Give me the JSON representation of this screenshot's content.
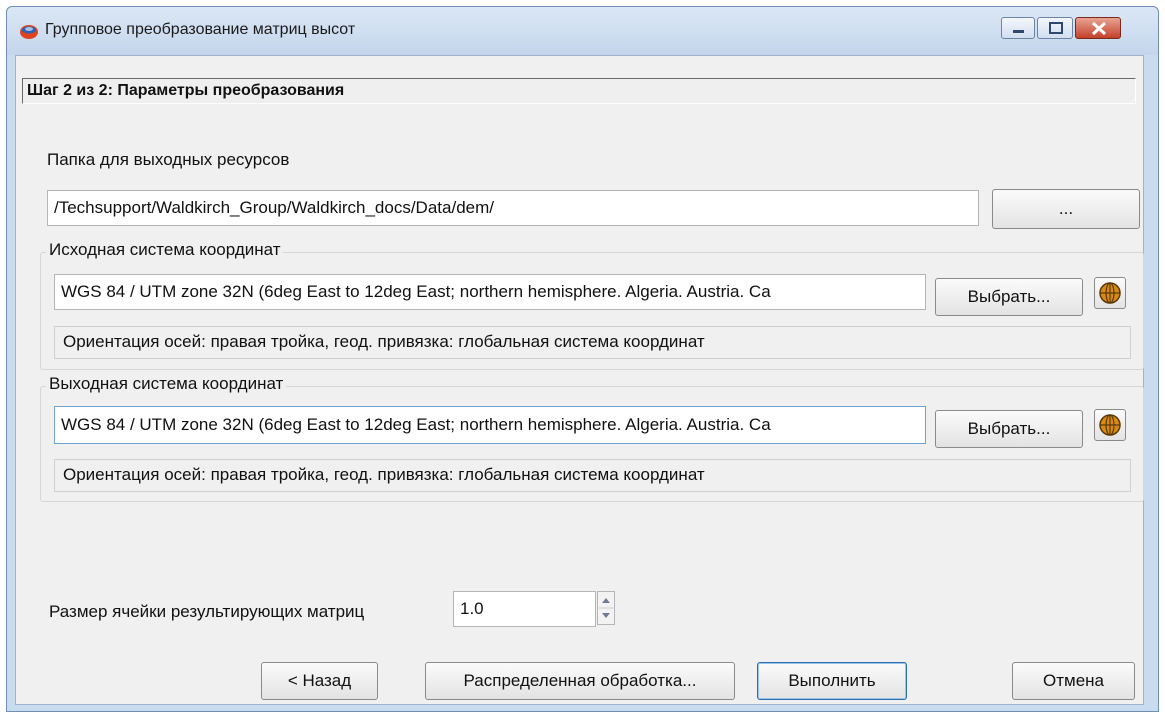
{
  "window": {
    "title": "Групповое преобразование матриц высот"
  },
  "step": {
    "label": "Шаг 2 из 2: Параметры преобразования"
  },
  "output_folder": {
    "label": "Папка для выходных ресурсов",
    "value": "/Techsupport/Waldkirch_Group/Waldkirch_docs/Data/dem/",
    "browse_label": "..."
  },
  "source_cs": {
    "group_title": "Исходная система координат",
    "value": "WGS 84 / UTM zone 32N (6deg East to 12deg East; northern hemisphere. Algeria. Austria. Ca",
    "select_label": "Выбрать...",
    "orientation": "Ориентация осей: правая тройка, геод. привязка: глобальная система координат",
    "globe_icon": "globe-icon"
  },
  "output_cs": {
    "group_title": "Выходная система координат",
    "value": "WGS 84 / UTM zone 32N (6deg East to 12deg East; northern hemisphere. Algeria. Austria. Ca",
    "select_label": "Выбрать...",
    "orientation": "Ориентация осей: правая тройка, геод. привязка: глобальная система координат",
    "globe_icon": "globe-icon"
  },
  "cell_size": {
    "label": "Размер ячейки результирующих матриц",
    "value": "1.0"
  },
  "footer": {
    "back_label": "< Назад",
    "distributed_label": "Распределенная обработка...",
    "execute_label": "Выполнить",
    "cancel_label": "Отмена"
  },
  "colors": {
    "titlebar": "#c4d6ec",
    "client_bg": "#f0f0f0",
    "close_button": "#c4412b",
    "focus_border": "#6fa3d8"
  }
}
